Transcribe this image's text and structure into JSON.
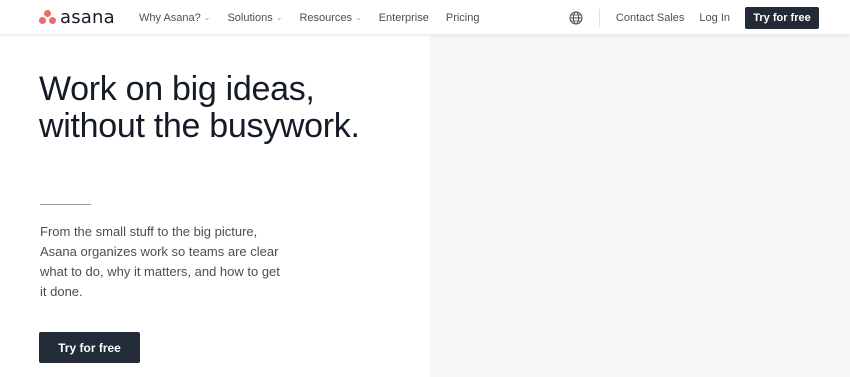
{
  "brand": {
    "name": "asana",
    "mark_color": "#f06a6a"
  },
  "nav": {
    "items": [
      {
        "label": "Why Asana?",
        "has_dropdown": true
      },
      {
        "label": "Solutions",
        "has_dropdown": true
      },
      {
        "label": "Resources",
        "has_dropdown": true
      },
      {
        "label": "Enterprise",
        "has_dropdown": false
      },
      {
        "label": "Pricing",
        "has_dropdown": false
      }
    ],
    "dropdown_glyph": "⌄",
    "globe_icon": "globe-icon",
    "contact_sales": "Contact Sales",
    "log_in": "Log In",
    "cta_label": "Try for free"
  },
  "hero": {
    "headline_line1": "Work on big ideas,",
    "headline_line2": "without the busywork.",
    "body_line1": "From the small stuff to the big picture,",
    "body_line2": "Asana organizes work so teams are clear",
    "body_line3": "what to do, why it matters, and how to get",
    "body_line4": "it done.",
    "cta_label": "Try for free"
  },
  "colors": {
    "button_bg": "#222b37",
    "text_primary": "#151b26",
    "text_secondary": "#4a4f55",
    "right_panel_bg": "#f6f6f7"
  }
}
